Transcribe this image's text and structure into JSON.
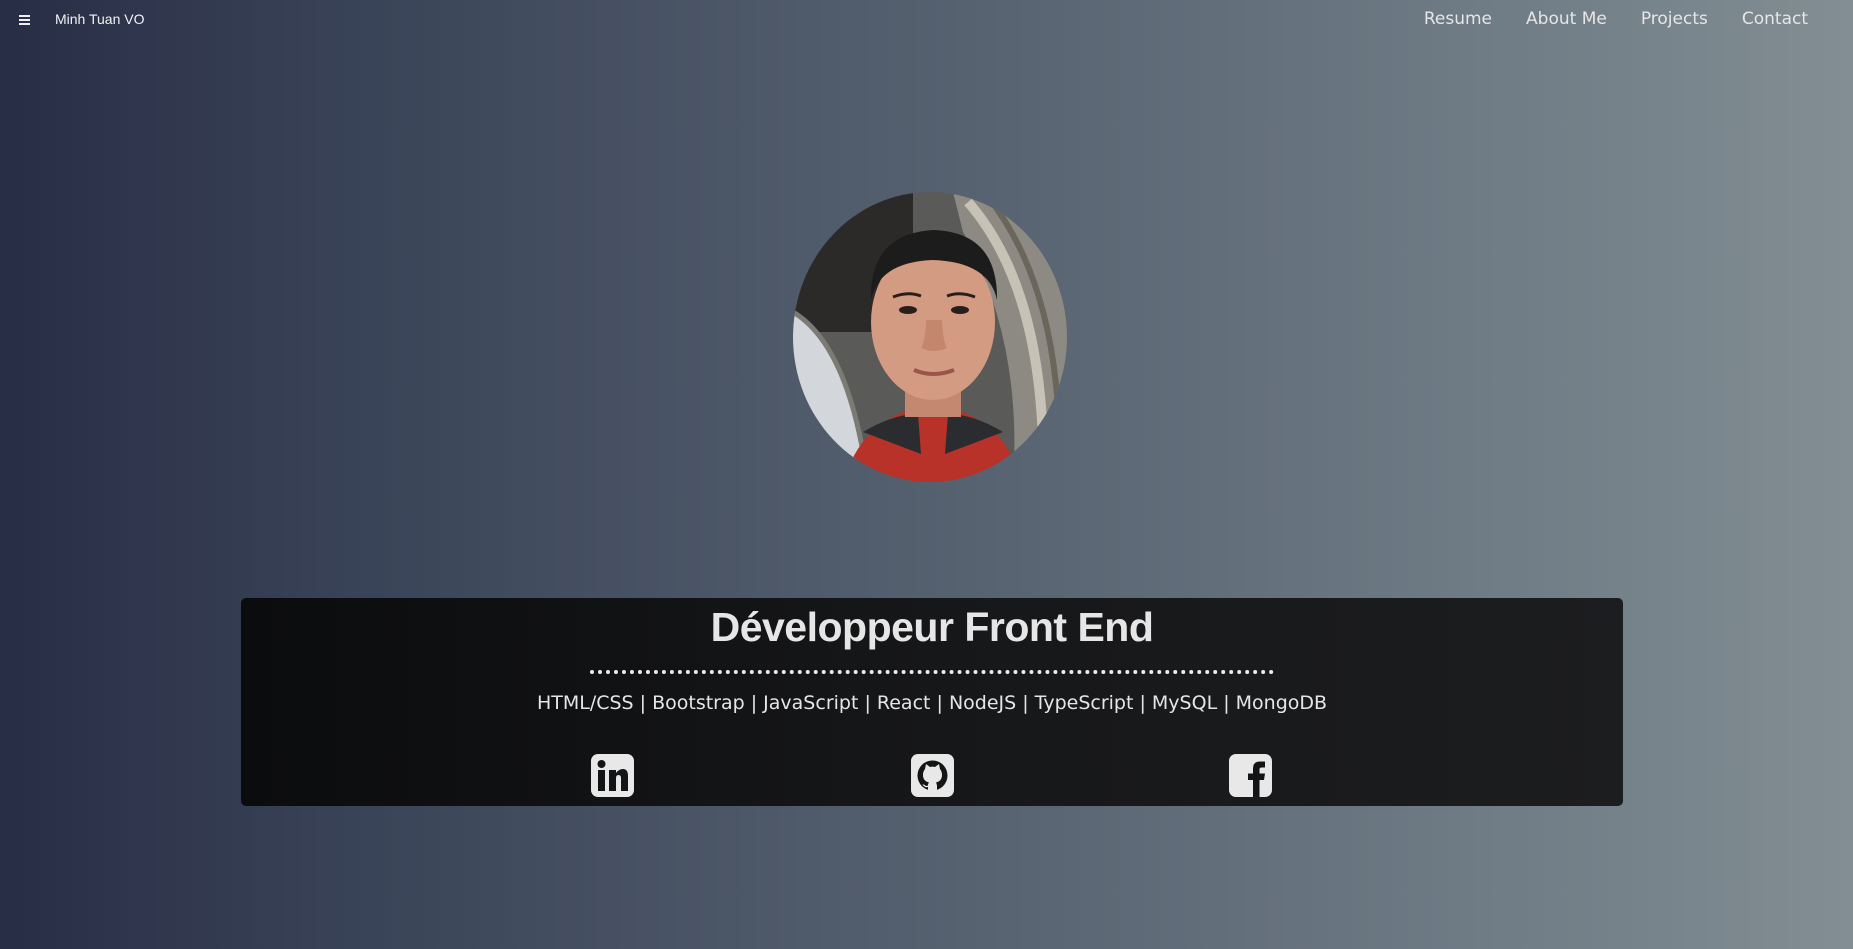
{
  "navbar": {
    "menu_icon": "hamburger-menu-icon",
    "brand": "Minh Tuan VO",
    "links": [
      {
        "label": "Resume"
      },
      {
        "label": "About Me"
      },
      {
        "label": "Projects"
      },
      {
        "label": "Contact"
      }
    ]
  },
  "hero": {
    "avatar_alt": "profile-photo",
    "title": "Développeur Front End",
    "skills": "HTML/CSS | Bootstrap | JavaScript | React | NodeJS | TypeScript | MySQL | MongoDB",
    "social": [
      {
        "icon": "linkedin-icon"
      },
      {
        "icon": "github-icon"
      },
      {
        "icon": "facebook-icon"
      }
    ]
  },
  "colors": {
    "background_start": "#282d46",
    "background_end": "#828e93",
    "card": "#131416",
    "text": "#e6e6e6"
  }
}
